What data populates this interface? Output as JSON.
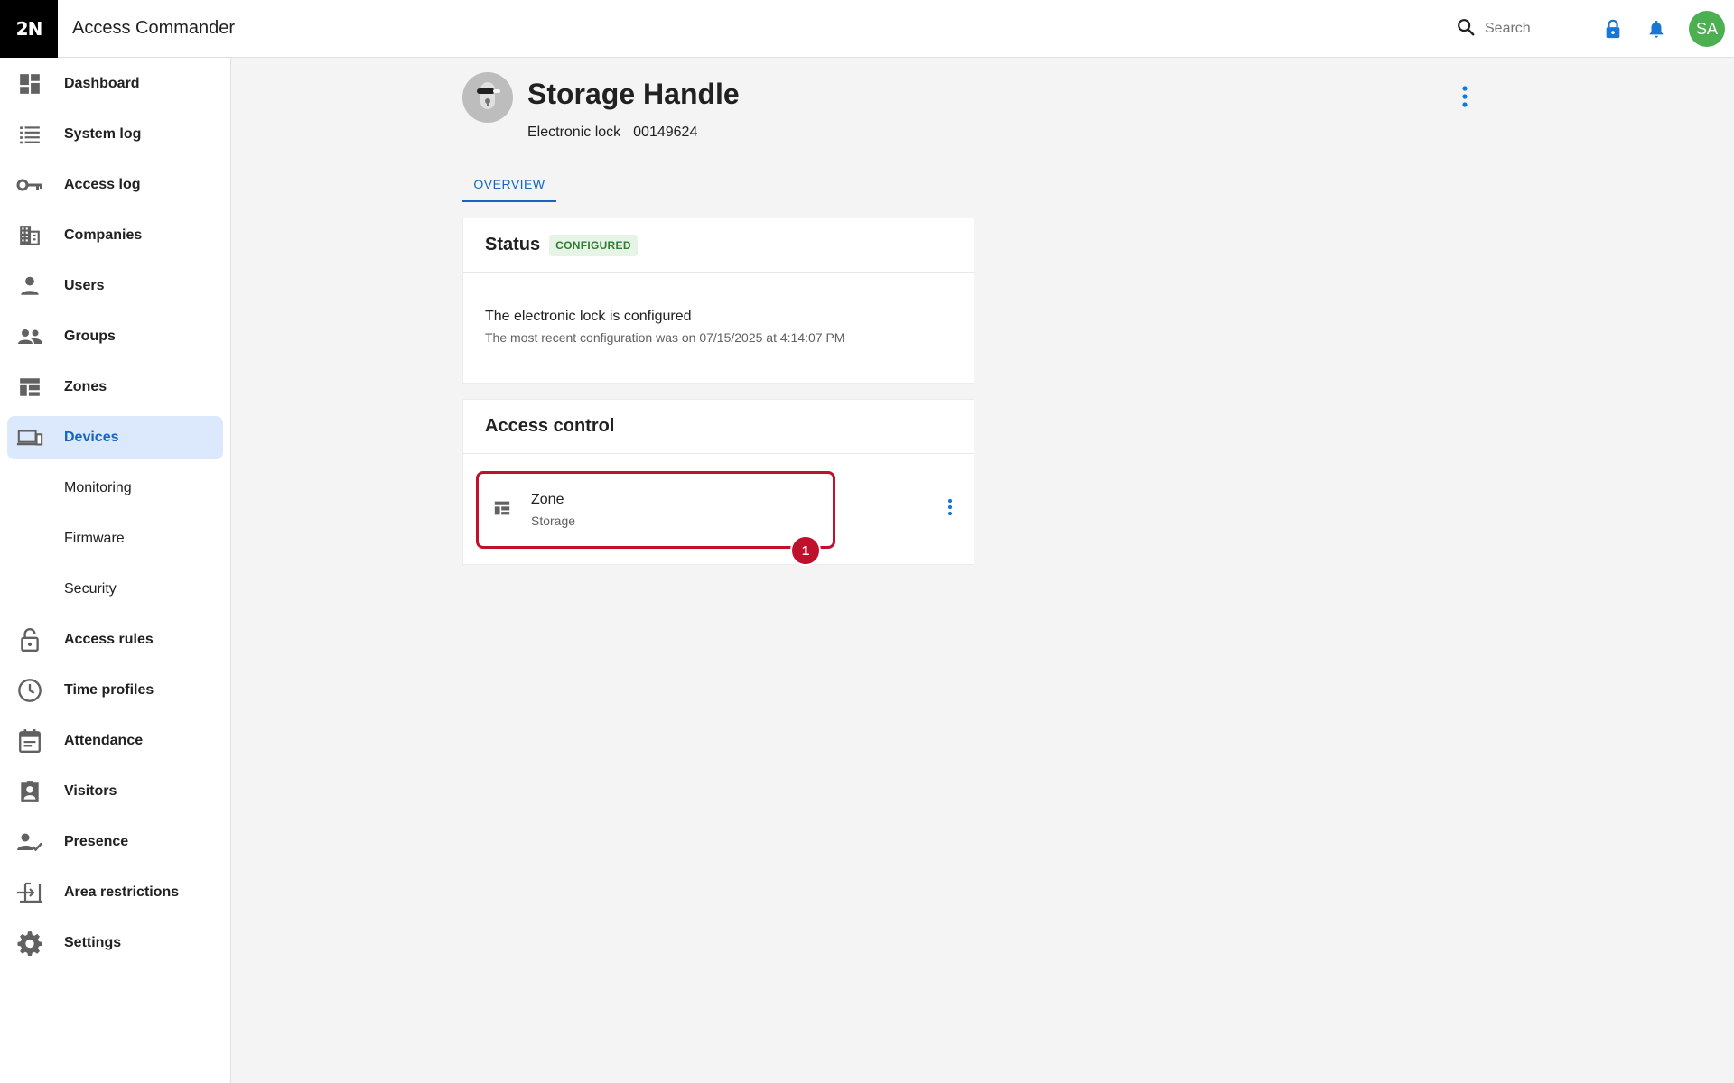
{
  "header": {
    "logo": "2N",
    "app_title": "Access Commander",
    "search_placeholder": "Search",
    "avatar_initials": "SA",
    "colors": {
      "accent": "#1565c0",
      "avatar": "#4caf50"
    }
  },
  "sidebar": {
    "items": [
      {
        "label": "Dashboard",
        "icon": "dashboard-icon"
      },
      {
        "label": "System log",
        "icon": "list-icon"
      },
      {
        "label": "Access log",
        "icon": "key-icon"
      },
      {
        "label": "Companies",
        "icon": "building-icon"
      },
      {
        "label": "Users",
        "icon": "person-icon"
      },
      {
        "label": "Groups",
        "icon": "group-icon"
      },
      {
        "label": "Zones",
        "icon": "zones-icon"
      },
      {
        "label": "Devices",
        "icon": "devices-icon",
        "active": true
      },
      {
        "label": "Monitoring",
        "sub": true
      },
      {
        "label": "Firmware",
        "sub": true
      },
      {
        "label": "Security",
        "sub": true
      },
      {
        "label": "Access rules",
        "icon": "lock-open-icon"
      },
      {
        "label": "Time profiles",
        "icon": "clock-icon"
      },
      {
        "label": "Attendance",
        "icon": "calendar-icon"
      },
      {
        "label": "Visitors",
        "icon": "visitor-badge-icon"
      },
      {
        "label": "Presence",
        "icon": "person-check-icon"
      },
      {
        "label": "Area restrictions",
        "icon": "area-restriction-icon"
      },
      {
        "label": "Settings",
        "icon": "gear-icon"
      }
    ]
  },
  "device": {
    "name": "Storage Handle",
    "type": "Electronic lock",
    "serial": "00149624"
  },
  "tabs": [
    {
      "label": "OVERVIEW",
      "active": true
    }
  ],
  "status_card": {
    "title": "Status",
    "badge": "CONFIGURED",
    "message": "The electronic lock is configured",
    "detail": "The most recent configuration was on 07/15/2025 at 4:14:07 PM"
  },
  "access_card": {
    "title": "Access control",
    "zone_label": "Zone",
    "zone_value": "Storage",
    "marker": "1"
  }
}
